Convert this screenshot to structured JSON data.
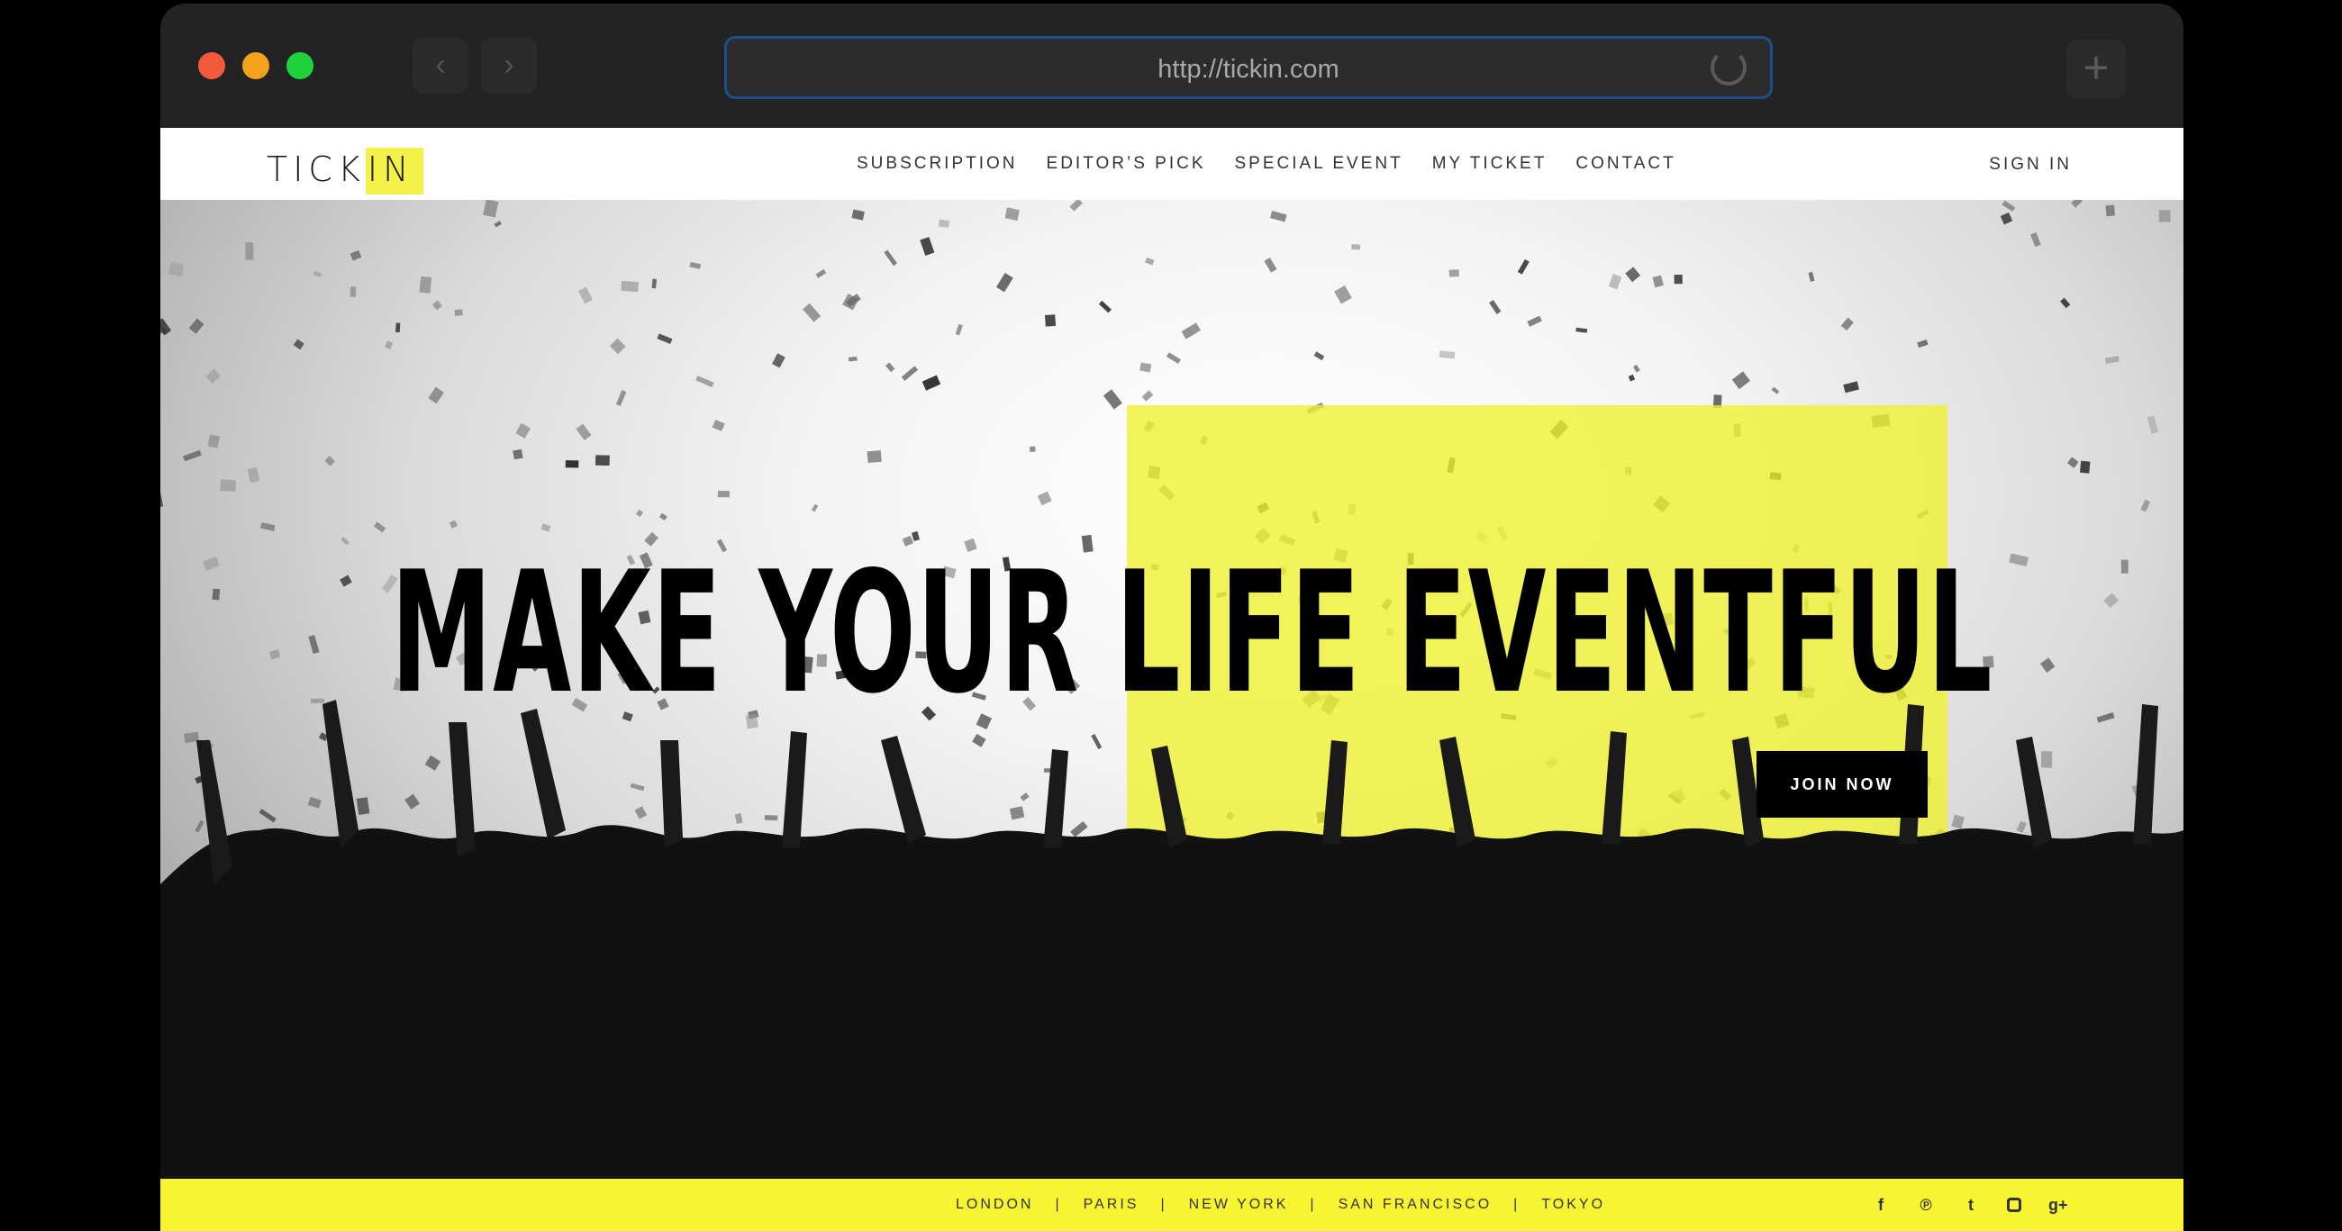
{
  "browser": {
    "url": "http://tickin.com",
    "back_icon": "‹",
    "forward_icon": "›",
    "new_tab_icon": "+"
  },
  "site": {
    "logo_a": "TICK",
    "logo_b": "IN",
    "nav": [
      "SUBSCRIPTION",
      "EDITOR’S PICK",
      "SPECIAL EVENT",
      "MY TICKET",
      "CONTACT"
    ],
    "sign_in": "SIGN IN"
  },
  "hero": {
    "headline": "MAKE YOUR LIFE EVENTFUL",
    "cta": "JOIN NOW"
  },
  "footer": {
    "cities": [
      "LONDON",
      "PARIS",
      "NEW YORK",
      "SAN FRANCISCO",
      "TOKYO"
    ],
    "separator": "|",
    "social": {
      "facebook": "f",
      "pinterest": "℗",
      "twitter": "t",
      "googleplus": "g+"
    }
  },
  "colors": {
    "accent": "#f4f14a",
    "footer": "#f7f531",
    "url_border": "#1d4f8c"
  }
}
